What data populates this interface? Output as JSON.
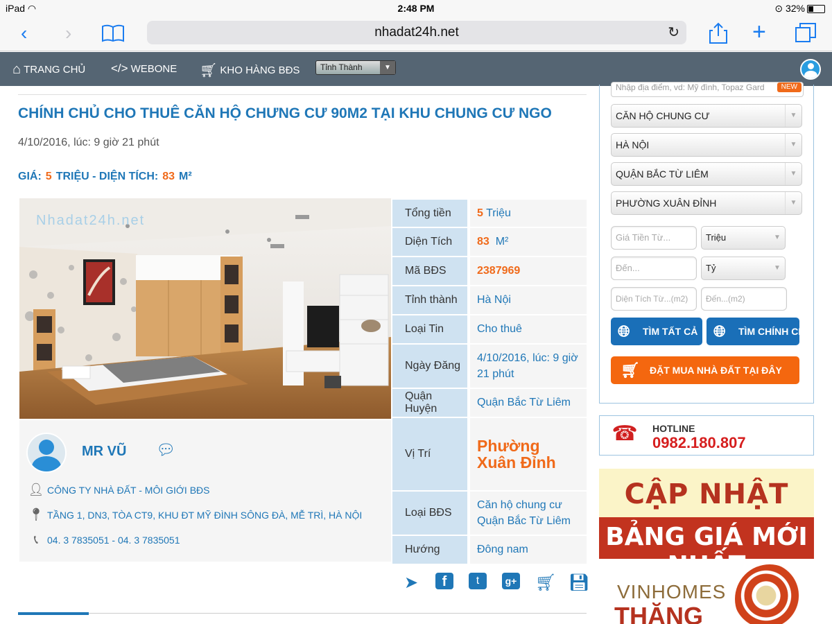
{
  "status_bar": {
    "device": "iPad",
    "time": "2:48 PM",
    "battery": "32%"
  },
  "browser": {
    "url": "nhadat24h.net"
  },
  "site_nav": {
    "items": [
      {
        "label": "TRANG CHỦ",
        "icon": "home-icon"
      },
      {
        "label": "WEBONE",
        "icon": "code-icon"
      },
      {
        "label": "KHO HÀNG BĐS",
        "icon": "cart-icon"
      }
    ],
    "province_select": "Tỉnh Thành"
  },
  "listing": {
    "title": "CHÍNH CHỦ CHO THUÊ CĂN HỘ CHƯNG CƯ 90M2 TẠI KHU CHUNG CƯ NGO",
    "posted": "4/10/2016, lúc: 9 giờ 21 phút",
    "price_label": "GIÁ:",
    "price_value": "5",
    "price_unit": "TRIỆU - DIỆN TÍCH:",
    "area_value": "83",
    "area_unit": "M²",
    "watermark": "Nhadat24h.net"
  },
  "agent": {
    "name": "MR VŨ",
    "company": "CÔNG TY NHÀ ĐẤT - MÔI GIỚI BĐS",
    "address": "TẦNG 1, DN3, TÒA CT9, KHU ĐT MỸ ĐÌNH SÔNG ĐÀ, MỄ TRÌ, HÀ NỘI",
    "phone": "04. 3 7835051 - 04. 3 7835051"
  },
  "details": {
    "tong_tien_k": "Tổng tiền",
    "tong_tien_num": "5",
    "tong_tien_unit": "Triệu",
    "dien_tich_k": "Diện Tích",
    "dien_tich_num": "83",
    "dien_tich_unit": "M²",
    "ma_bds_k": "Mã BĐS",
    "ma_bds_v": "2387969",
    "tinh_k": "Tỉnh thành",
    "tinh_v": "Hà Nội",
    "loai_tin_k": "Loại Tin",
    "loai_tin_v": "Cho thuê",
    "ngay_dang_k": "Ngày Đăng",
    "ngay_dang_v": "4/10/2016, lúc: 9 giờ 21 phút",
    "quan_k": "Quận Huyện",
    "quan_v": "Quận Bắc Từ Liêm",
    "vi_tri_k": "Vị Trí",
    "vi_tri_v": "Phường Xuân Đỉnh",
    "loai_bds_k": "Loại BĐS",
    "loai_bds_v": "Căn hộ chung cư Quận Bắc Từ Liêm",
    "huong_k": "Hướng",
    "huong_v": "Đông nam"
  },
  "sidebar": {
    "search_placeholder": "Nhập địa điểm, vd: Mỹ đình, Topaz Gard",
    "new_badge": "NEW",
    "type_select": "CĂN HỘ CHUNG CƯ",
    "city_select": "HÀ NỘI",
    "district_select": "QUẬN BẮC TỪ LIÊM",
    "ward_select": "PHƯỜNG XUÂN ĐỈNH",
    "price_from_ph": "Giá Tiền Từ...",
    "price_unit_1": "Triệu",
    "price_to_ph": "Đến...",
    "price_unit_2": "Tỷ",
    "area_from_ph": "Diện Tích Từ...(m2)",
    "area_to_ph": "Đến...(m2)",
    "btn_search_all": "TÌM TẤT CẢ",
    "btn_search_owner": "TÌM CHÍNH CHỦ",
    "btn_buy": "ĐẶT MUA NHÀ ĐẤT TẠI ĐÂY",
    "hotline_label": "HOTLINE",
    "hotline_number": "0982.180.807"
  },
  "banners": {
    "b1_line1": "CẬP NHẬT",
    "b1_line2": "BẢNG GIÁ MỚI NHẤT",
    "b2_line1": "VINHOMES",
    "b2_line2": "THĂNG"
  },
  "colors": {
    "nav_bg": "#556573",
    "brand_blue": "#1f77b7",
    "accent_orange": "#f06a1a",
    "hotline_red": "#d61e1e"
  }
}
